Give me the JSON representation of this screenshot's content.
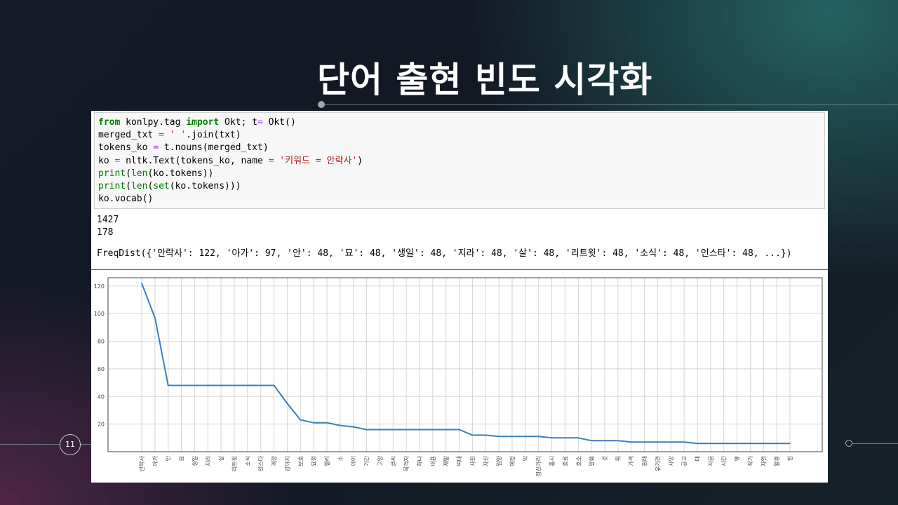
{
  "slide": {
    "title": "단어 출현 빈도 시각화",
    "page_number": "11"
  },
  "code_cell": {
    "lines": [
      [
        {
          "t": "from",
          "c": "kw"
        },
        {
          "t": " konlpy.tag ",
          "c": ""
        },
        {
          "t": "import",
          "c": "kw"
        },
        {
          "t": " Okt; t",
          "c": ""
        },
        {
          "t": "=",
          "c": "op"
        },
        {
          "t": " Okt()",
          "c": ""
        }
      ],
      [
        {
          "t": "merged_txt ",
          "c": ""
        },
        {
          "t": "=",
          "c": "op"
        },
        {
          "t": " ",
          "c": ""
        },
        {
          "t": "' '",
          "c": "str"
        },
        {
          "t": ".join(txt)",
          "c": ""
        }
      ],
      [
        {
          "t": "tokens_ko ",
          "c": ""
        },
        {
          "t": "=",
          "c": "op"
        },
        {
          "t": " t.nouns(merged_txt)",
          "c": ""
        }
      ],
      [
        {
          "t": "ko ",
          "c": ""
        },
        {
          "t": "=",
          "c": "op"
        },
        {
          "t": " nltk.Text(tokens_ko, name ",
          "c": ""
        },
        {
          "t": "=",
          "c": "op"
        },
        {
          "t": " ",
          "c": ""
        },
        {
          "t": "'키워드 = 안락사'",
          "c": "str"
        },
        {
          "t": ")",
          "c": ""
        }
      ],
      [
        {
          "t": "print",
          "c": "bi"
        },
        {
          "t": "(",
          "c": ""
        },
        {
          "t": "len",
          "c": "bi"
        },
        {
          "t": "(ko.tokens))",
          "c": ""
        }
      ],
      [
        {
          "t": "print",
          "c": "bi"
        },
        {
          "t": "(",
          "c": ""
        },
        {
          "t": "len",
          "c": "bi"
        },
        {
          "t": "(",
          "c": ""
        },
        {
          "t": "set",
          "c": "bi"
        },
        {
          "t": "(ko.tokens)))",
          "c": ""
        }
      ],
      [
        {
          "t": "ko.vocab()",
          "c": ""
        }
      ]
    ]
  },
  "output": {
    "token_count": "1427",
    "unique_count": "178",
    "freqdist": "FreqDist({'안락사': 122, '아가': 97, '안': 48, '묘': 48, '생일': 48, '지라': 48, '살': 48, '리트윗': 48, '소식': 48, '인스타': 48, ...})"
  },
  "colors": {
    "line": "#3a7fbf",
    "grid": "#d6d6d6",
    "frame": "#444444"
  },
  "chart_data": {
    "type": "line",
    "categories": [
      "안락사",
      "아가",
      "안",
      "묘",
      "생일",
      "지라",
      "살",
      "리트윗",
      "소식",
      "인스타",
      "계정",
      "강아지",
      "보호",
      "요정",
      "엘리",
      "소",
      "아이",
      "기간",
      "고양",
      "글씨",
      "목격자",
      "하나",
      "내용",
      "재발",
      "떡대",
      "사진",
      "자신",
      "입양",
      "예정",
      "약",
      "정신가리",
      "홍시",
      "종료",
      "호소",
      "말씀",
      "것",
      "뭐",
      "가격",
      "원래",
      "유기견",
      "사망",
      "공고",
      "데",
      "지금",
      "시간",
      "옆",
      "작가",
      "자연",
      "활용",
      "칭"
    ],
    "values": [
      122,
      97,
      48,
      48,
      48,
      48,
      48,
      48,
      48,
      48,
      48,
      35,
      23,
      21,
      21,
      19,
      18,
      16,
      16,
      16,
      16,
      16,
      16,
      16,
      16,
      12,
      12,
      11,
      11,
      11,
      11,
      10,
      10,
      10,
      8,
      8,
      8,
      7,
      7,
      7,
      7,
      7,
      6,
      6,
      6,
      6,
      6,
      6,
      6,
      6
    ],
    "yticks": [
      20,
      40,
      60,
      80,
      100,
      120
    ],
    "ylim": [
      0,
      126
    ],
    "grid": true
  }
}
